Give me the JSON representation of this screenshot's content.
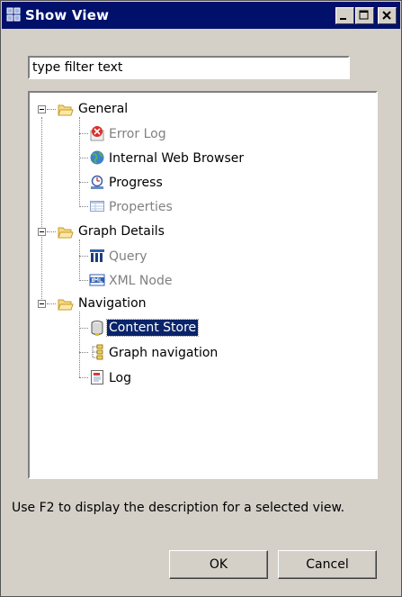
{
  "window": {
    "title": "Show View",
    "controls": [
      "minimize",
      "maximize",
      "close"
    ]
  },
  "filter": {
    "value": "type filter text",
    "placeholder": "type filter text"
  },
  "tree": {
    "categories": [
      {
        "label": "General",
        "expanded": true,
        "items": [
          {
            "label": "Error Log",
            "icon": "error-log-icon",
            "enabled": false
          },
          {
            "label": "Internal Web Browser",
            "icon": "globe-icon",
            "enabled": true
          },
          {
            "label": "Progress",
            "icon": "progress-icon",
            "enabled": true
          },
          {
            "label": "Properties",
            "icon": "properties-icon",
            "enabled": false
          }
        ]
      },
      {
        "label": "Graph Details",
        "expanded": true,
        "items": [
          {
            "label": "Query",
            "icon": "query-icon",
            "enabled": false
          },
          {
            "label": "XML Node",
            "icon": "xml-icon",
            "enabled": false
          }
        ]
      },
      {
        "label": "Navigation",
        "expanded": true,
        "items": [
          {
            "label": "Content Store",
            "icon": "database-icon",
            "enabled": true,
            "selected": true
          },
          {
            "label": "Graph navigation",
            "icon": "hierarchy-icon",
            "enabled": true
          },
          {
            "label": "Log",
            "icon": "log-icon",
            "enabled": true
          }
        ]
      }
    ]
  },
  "hint": "Use F2 to display the description for a selected view.",
  "buttons": {
    "ok": "OK",
    "cancel": "Cancel"
  },
  "colors": {
    "titlebar": "#00106b",
    "selection": "#0a246a",
    "face": "#d4d0c8"
  }
}
